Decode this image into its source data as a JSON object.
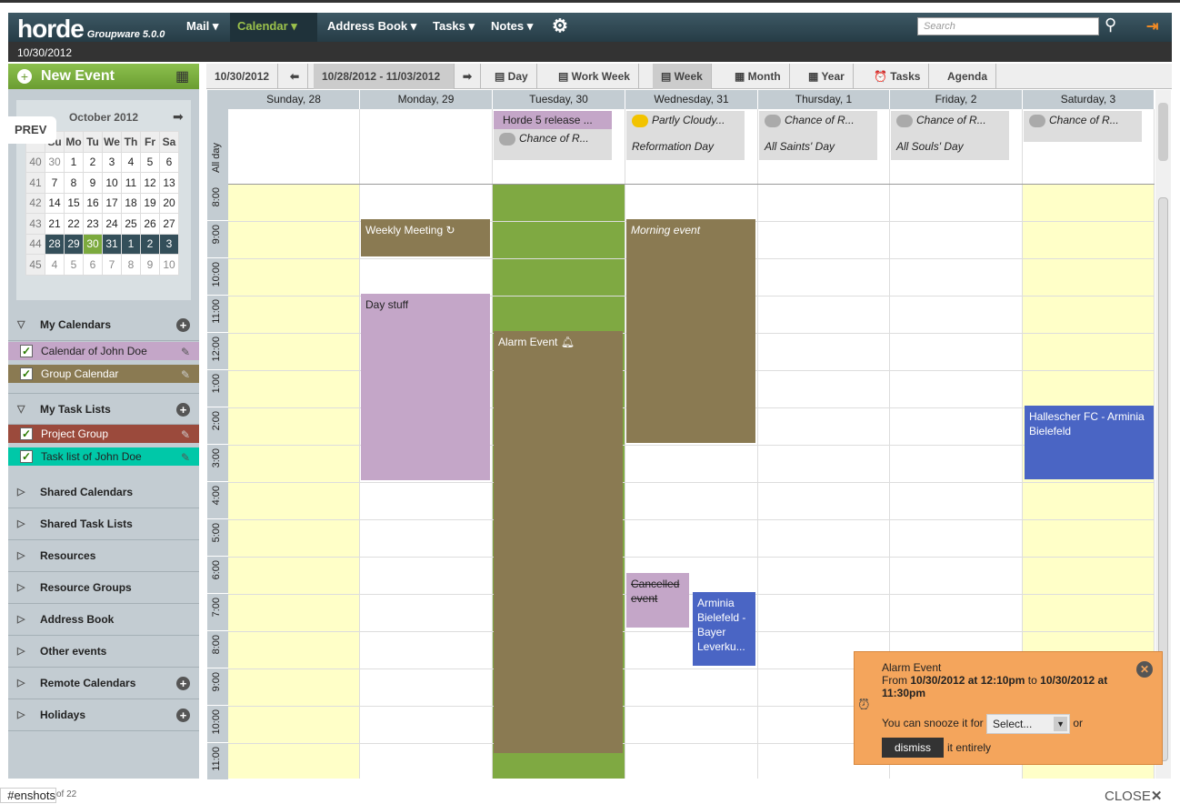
{
  "app": {
    "logo": "horde",
    "product": "Groupware 5.0.0",
    "date": "10/30/2012"
  },
  "menu": [
    {
      "label": "Mail ▾"
    },
    {
      "label": "Calendar ▾"
    },
    {
      "label": "Address Book ▾"
    },
    {
      "label": "Tasks ▾"
    },
    {
      "label": "Notes ▾"
    }
  ],
  "search": {
    "placeholder": "Search"
  },
  "sidebar": {
    "new_event": "New Event",
    "minical": {
      "title": "October 2012",
      "headers": [
        "Su",
        "Mo",
        "Tu",
        "We",
        "Th",
        "Fr",
        "Sa"
      ],
      "weeks": [
        [
          "40",
          "30",
          "1",
          "2",
          "3",
          "4",
          "5",
          "6"
        ],
        [
          "41",
          "7",
          "8",
          "9",
          "10",
          "11",
          "12",
          "13"
        ],
        [
          "42",
          "14",
          "15",
          "16",
          "17",
          "18",
          "19",
          "20"
        ],
        [
          "43",
          "21",
          "22",
          "23",
          "24",
          "25",
          "26",
          "27"
        ],
        [
          "44",
          "28",
          "29",
          "30",
          "31",
          "1",
          "2",
          "3"
        ],
        [
          "45",
          "4",
          "5",
          "6",
          "7",
          "8",
          "9",
          "10"
        ]
      ]
    },
    "my_calendars": "My Calendars",
    "calendars": [
      {
        "label": "Calendar of John Doe",
        "color": "#c4a6c8"
      },
      {
        "label": "Group Calendar",
        "color": "#8a7a52"
      }
    ],
    "my_task_lists": "My Task Lists",
    "tasklists": [
      {
        "label": "Project Group",
        "color": "#9b4a3c"
      },
      {
        "label": "Task list of John Doe",
        "color": "#00c8a8"
      }
    ],
    "sections": [
      "Shared Calendars",
      "Shared Task Lists",
      "Resources",
      "Resource Groups",
      "Address Book",
      "Other events",
      "Remote Calendars",
      "Holidays"
    ]
  },
  "toolbar": {
    "today": "10/30/2012",
    "range": "10/28/2012 - 11/03/2012",
    "views": [
      "Day",
      "Work Week",
      "Week",
      "Month",
      "Year",
      "Tasks",
      "Agenda"
    ],
    "selected": "Week"
  },
  "days": [
    "Sunday, 28",
    "Monday, 29",
    "Tuesday, 30",
    "Wednesday, 31",
    "Thursday, 1",
    "Friday, 2",
    "Saturday, 3"
  ],
  "allday_label": "All day",
  "hours": [
    "8:00",
    "9:00",
    "10:00",
    "11:00",
    "12:00",
    "1:00",
    "2:00",
    "3:00",
    "4:00",
    "5:00",
    "6:00",
    "7:00",
    "8:00",
    "9:00",
    "10:00",
    "11:00"
  ],
  "allday": {
    "tue_event": "Horde 5 release ...",
    "tue_weather": "Chance of R...",
    "wed_weather": "Partly Cloudy...",
    "wed_holiday": "Reformation Day",
    "thu_weather": "Chance of R...",
    "thu_holiday": "All Saints' Day",
    "fri_weather": "Chance of R...",
    "fri_holiday": "All Souls' Day",
    "sat_weather": "Chance of R..."
  },
  "events": {
    "weekly": "Weekly Meeting",
    "daystuff": "Day stuff",
    "alarm": "Alarm Event",
    "morning": "Morning event",
    "cancelled": "Cancelled event",
    "arminia": "Arminia Bielefeld - Bayer Leverku...",
    "hallescher": "Hallescher FC - Arminia Bielefeld"
  },
  "alarm_popup": {
    "title": "Alarm Event",
    "from": "From",
    "start": "10/30/2012 at 12:10pm",
    "to": "to",
    "end": "10/30/2012 at 11:30pm",
    "snooze_text": "You can snooze it for",
    "snooze_value": "Select...",
    "or": "or",
    "dismiss": "dismiss",
    "entirely": "it entirely"
  },
  "tooltip": "PREV",
  "footer": {
    "tab": "enshots#",
    "count": "of 22",
    "close": "CLOSE"
  }
}
